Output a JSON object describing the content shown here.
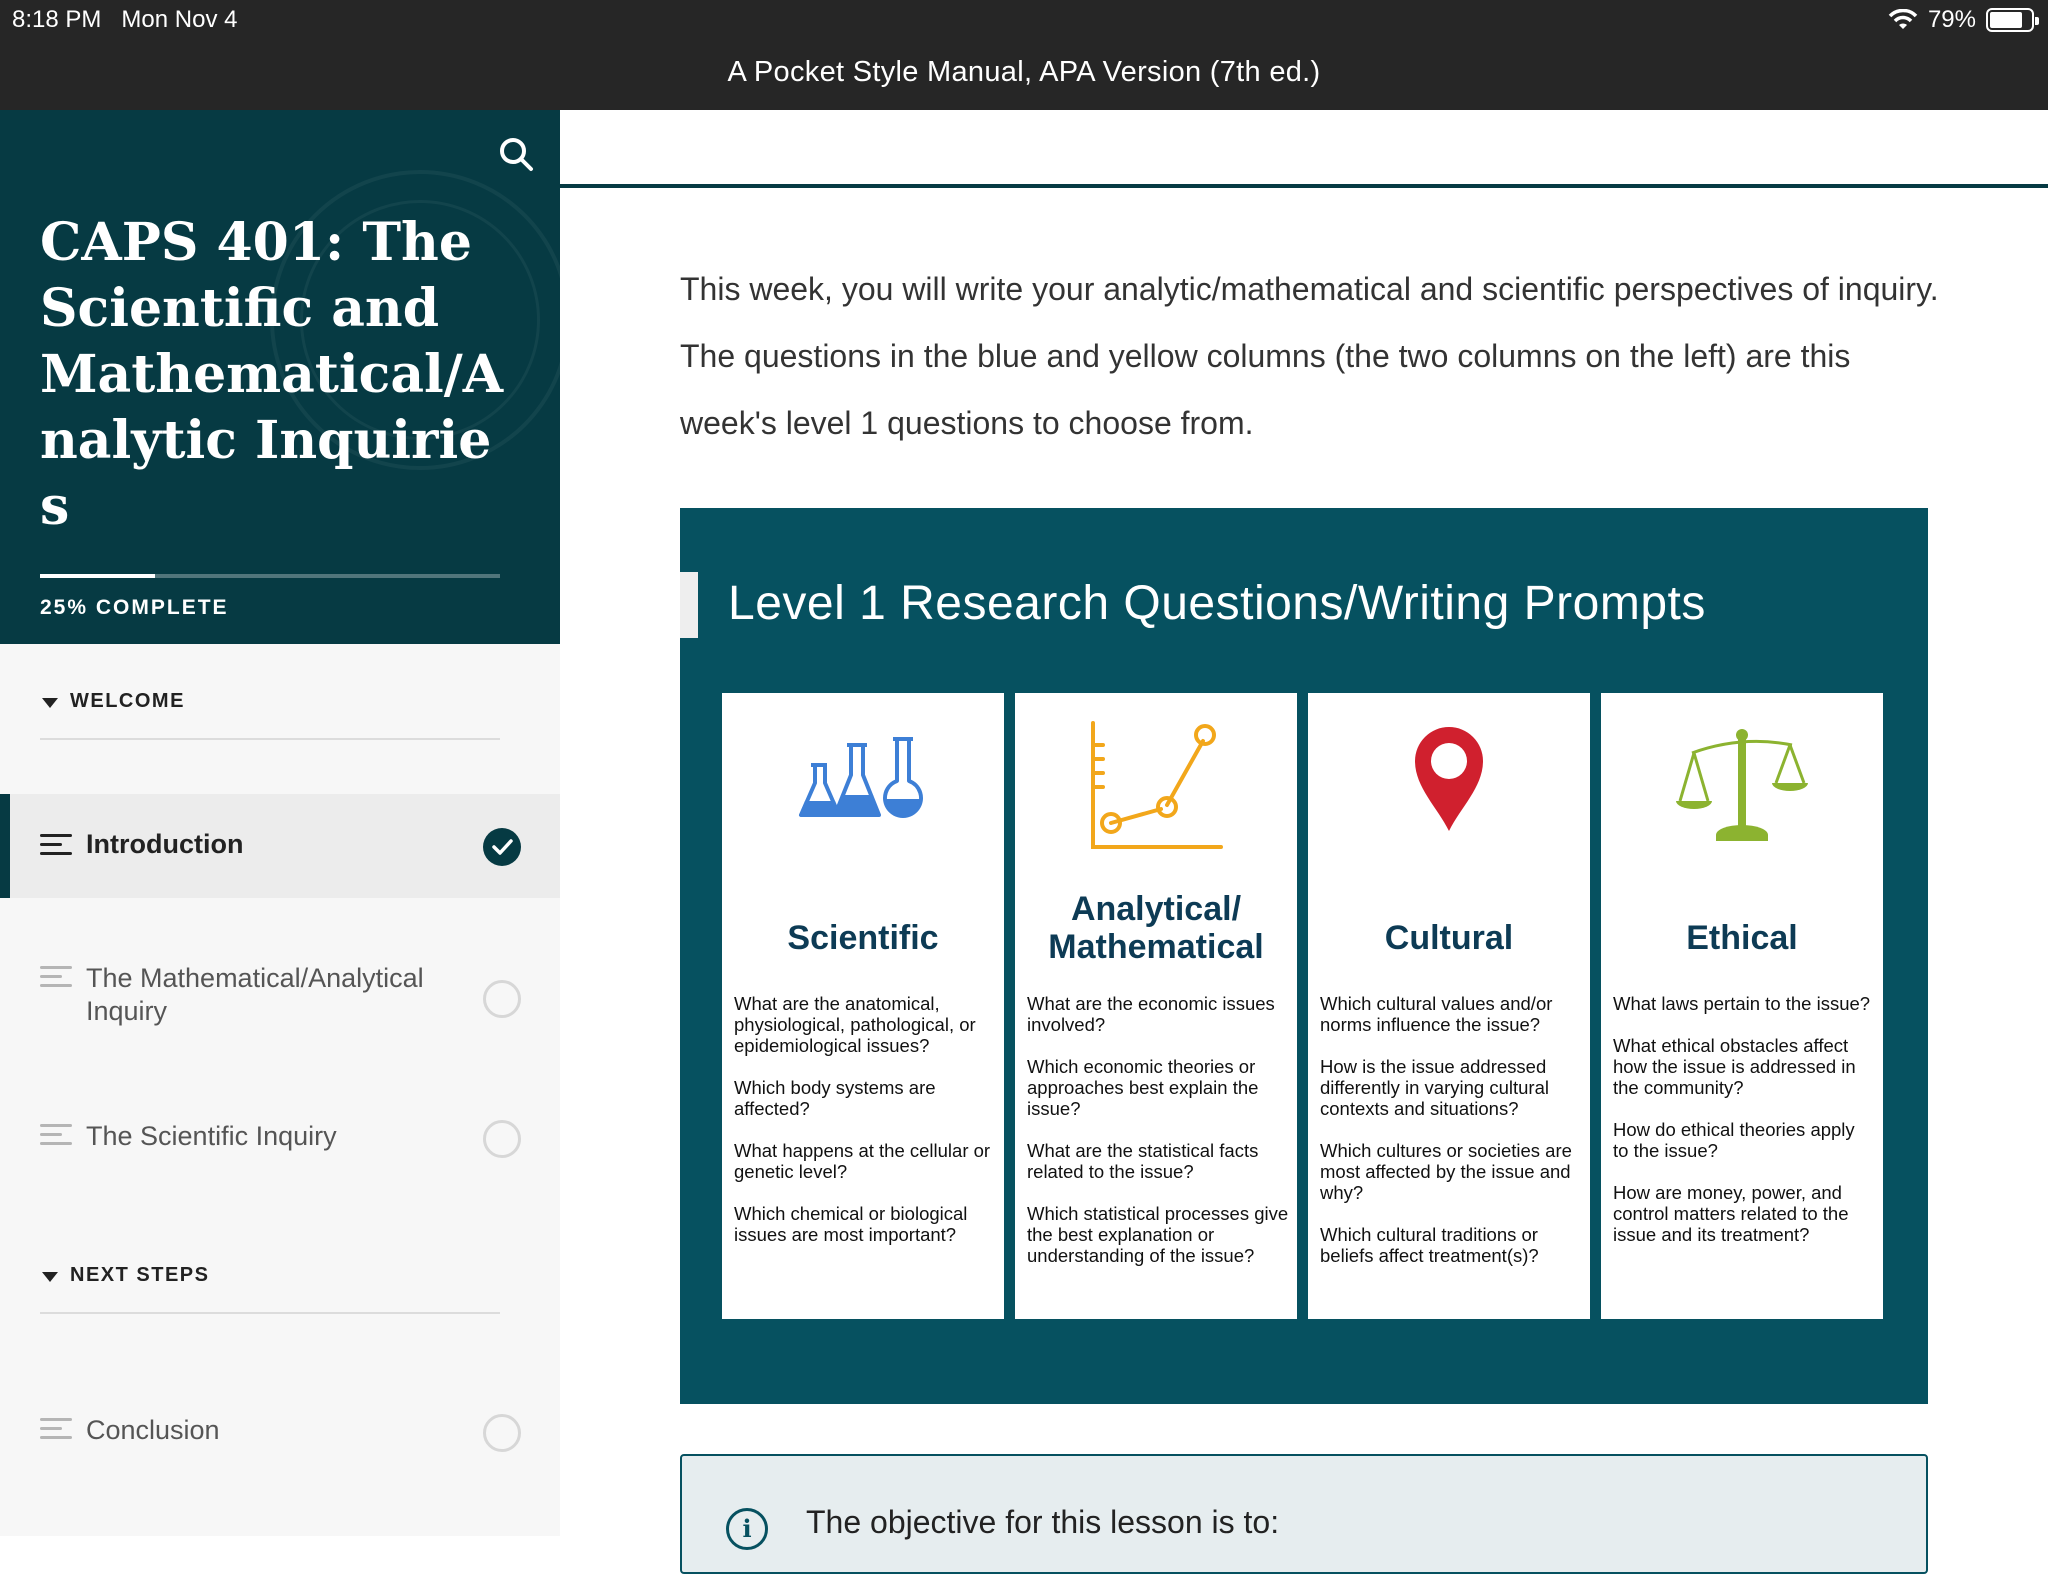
{
  "status": {
    "time": "8:18 PM",
    "date": "Mon Nov 4",
    "battery": "79%",
    "battery_level": 0.79
  },
  "app": {
    "title": "A Pocket Style Manual, APA Version (7th ed.)"
  },
  "sidebar": {
    "course_title": "CAPS 401: The Scientific and Mathematical/Analytic Inquiries",
    "progress_label": "25% COMPLETE",
    "progress": 0.25,
    "sections": [
      {
        "label": "WELCOME"
      },
      {
        "label": "NEXT STEPS"
      }
    ],
    "lessons": [
      {
        "label": "Introduction",
        "complete": true
      },
      {
        "label": "The Mathematical/Analytical Inquiry",
        "complete": false
      },
      {
        "label": "The Scientific Inquiry",
        "complete": false
      },
      {
        "label": "Conclusion",
        "complete": false
      }
    ]
  },
  "main": {
    "intro": "This week, you will write your analytic/mathematical and scientific perspectives of inquiry. The questions in the blue and yellow columns (the two columns on the left) are this week's level 1 questions to choose from.",
    "panel_title": "Level 1 Research Questions/Writing Prompts",
    "cards": [
      {
        "title": "Scientific",
        "icon": "flasks-icon",
        "color": "#3d7fd6",
        "questions": [
          "What are the anatomical, physiological, pathological, or epidemiological issues?",
          "Which body systems are affected?",
          "What happens at the cellular or genetic level?",
          "Which chemical or biological issues are most important?"
        ]
      },
      {
        "title": "Analytical/ Mathematical",
        "icon": "line-chart-icon",
        "color": "#f2a71b",
        "questions": [
          "What are the economic issues involved?",
          "Which economic theories or approaches best explain the issue?",
          "What are the statistical facts related to the issue?",
          "Which statistical processes give the best explanation or understanding of the issue?"
        ]
      },
      {
        "title": "Cultural",
        "icon": "map-pin-icon",
        "color": "#d0202e",
        "questions": [
          "Which cultural values and/or norms influence the issue?",
          "How is the issue addressed differently in varying cultural contexts and situations?",
          "Which cultures or societies are most affected by the issue and why?",
          "Which cultural traditions or beliefs affect treatment(s)?"
        ]
      },
      {
        "title": "Ethical",
        "icon": "scales-icon",
        "color": "#8cb330",
        "questions": [
          "What laws pertain to the issue?",
          "What ethical obstacles affect how the issue is addressed in the community?",
          "How do ethical theories apply to the issue?",
          "How are money, power, and control matters related to the issue and its treatment?"
        ]
      }
    ],
    "objective_text": "The objective for this lesson is to:"
  }
}
